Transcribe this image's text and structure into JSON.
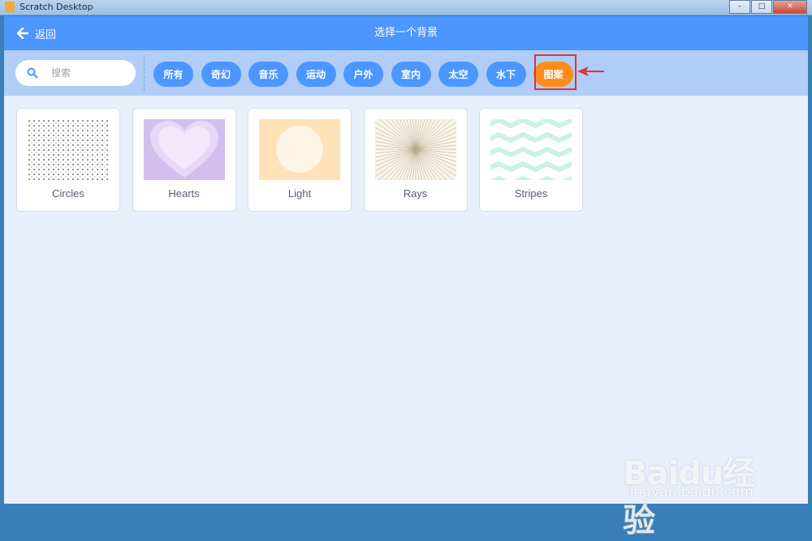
{
  "window": {
    "title": "Scratch Desktop",
    "minimize": "–",
    "maximize": "□",
    "close": "✕"
  },
  "header": {
    "back_label": "返回",
    "title": "选择一个背景"
  },
  "search": {
    "placeholder": "搜索"
  },
  "tags": [
    {
      "label": "所有",
      "active": false
    },
    {
      "label": "奇幻",
      "active": false
    },
    {
      "label": "音乐",
      "active": false
    },
    {
      "label": "运动",
      "active": false
    },
    {
      "label": "户外",
      "active": false
    },
    {
      "label": "室内",
      "active": false
    },
    {
      "label": "太空",
      "active": false
    },
    {
      "label": "水下",
      "active": false
    },
    {
      "label": "图案",
      "active": true
    }
  ],
  "backdrops": [
    {
      "name": "Circles"
    },
    {
      "name": "Hearts"
    },
    {
      "name": "Light"
    },
    {
      "name": "Rays"
    },
    {
      "name": "Stripes"
    }
  ],
  "colors": {
    "header": "#4c97ff",
    "filterbar": "#afcdf6",
    "tag": "#4c97ff",
    "tag_active": "#ff8c1a",
    "highlight": "#e2323c"
  },
  "watermark": {
    "logo": "Baidu经验",
    "url": "jingyan.baidu.com"
  }
}
